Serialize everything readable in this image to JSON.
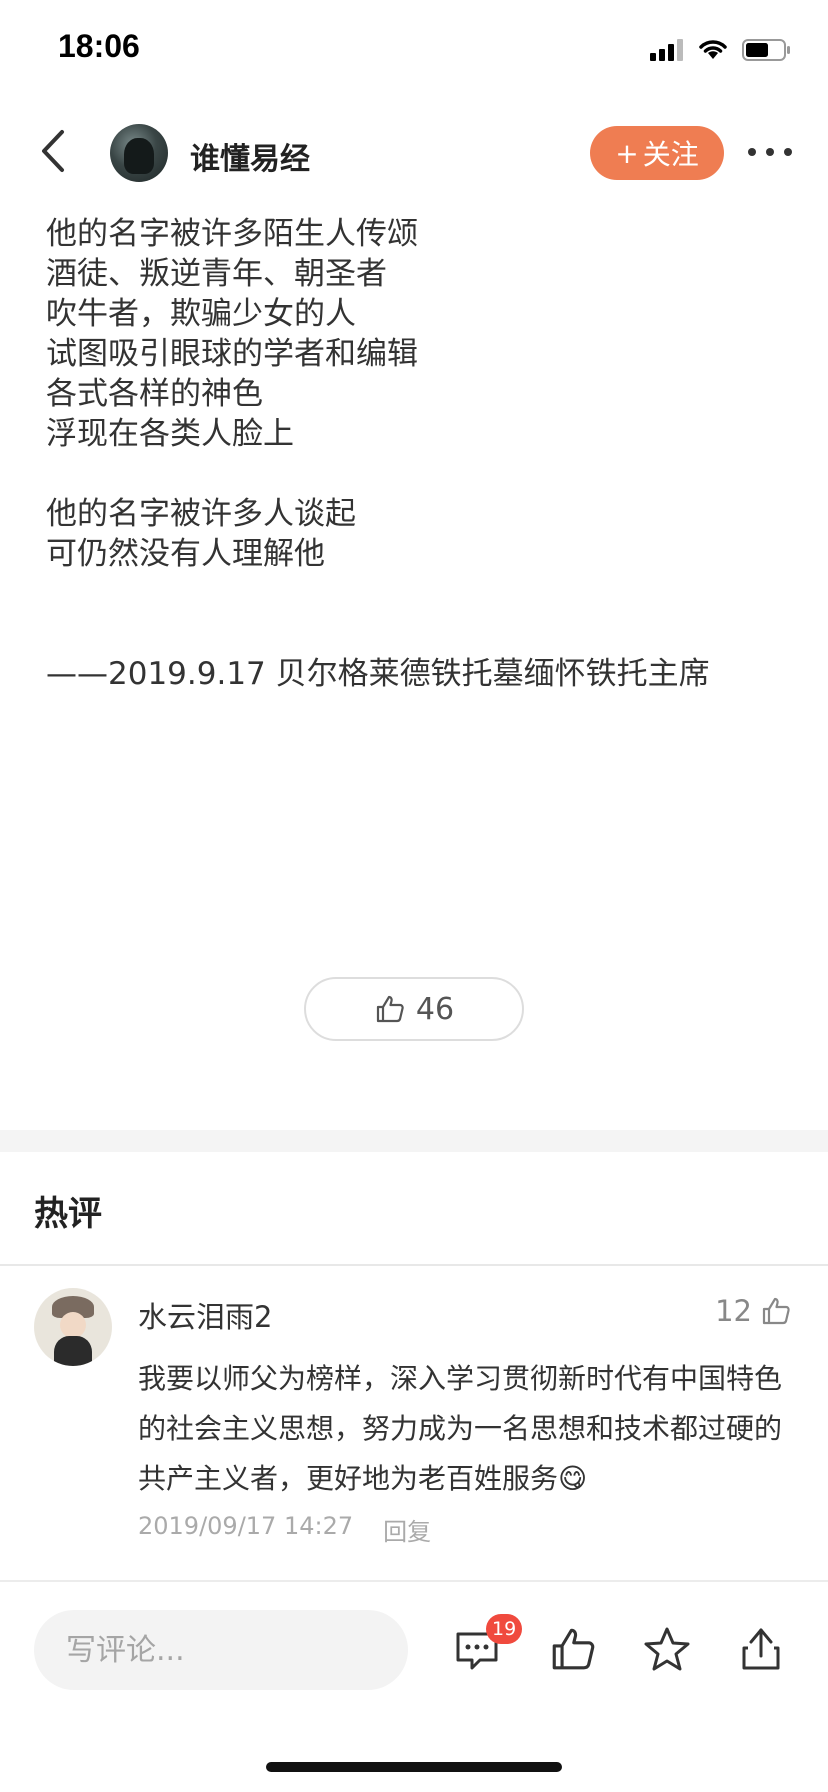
{
  "status": {
    "time": "18:06"
  },
  "header": {
    "author_name": "谁懂易经",
    "follow_label": "关注",
    "follow_plus": "+"
  },
  "article": {
    "lines": [
      "他的名字被许多陌生人传颂",
      "酒徒、叛逆青年、朝圣者",
      "吹牛者，欺骗少女的人",
      "试图吸引眼球的学者和编辑",
      "各式各样的神色",
      "浮现在各类人脸上",
      "",
      "他的名字被许多人谈起",
      "可仍然没有人理解他",
      "",
      "",
      "——2019.9.17 贝尔格莱德铁托墓缅怀铁托主席"
    ],
    "like_count": "46"
  },
  "hot_comments": {
    "title": "热评",
    "items": [
      {
        "user": "水云泪雨2",
        "likes": "12",
        "text": "我要以师父为榜样，深入学习贯彻新时代有中国特色的社会主义思想，努力成为一名思想和技术都过硬的共产主义者，更好地为老百姓服务",
        "emoji": "😋",
        "time": "2019/09/17 14:27",
        "reply_label": "回复"
      }
    ]
  },
  "bottom_bar": {
    "comment_placeholder": "写评论...",
    "comment_count": "19"
  },
  "icons": [
    "back-icon",
    "more-icon",
    "thumbs-up-icon",
    "comment-icon",
    "star-icon",
    "share-icon",
    "signal-icon",
    "wifi-icon",
    "battery-icon"
  ],
  "colors": {
    "accent": "#ef7d52",
    "badge": "#f04a3e"
  }
}
